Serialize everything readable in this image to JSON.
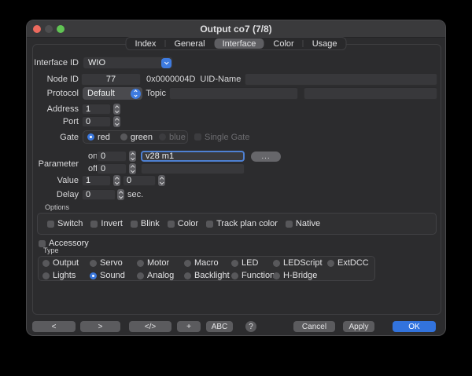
{
  "window": {
    "title": "Output co7 (7/8)"
  },
  "tabs": {
    "items": [
      {
        "label": "Index",
        "selected": false
      },
      {
        "label": "General",
        "selected": false
      },
      {
        "label": "Interface",
        "selected": true
      },
      {
        "label": "Color",
        "selected": false
      },
      {
        "label": "Usage",
        "selected": false
      }
    ]
  },
  "form": {
    "interface_id": {
      "label": "Interface ID",
      "value": "WIO"
    },
    "node": {
      "label": "Node ID",
      "value": "77",
      "hex": "0x0000004D",
      "uid_label": "UID-Name",
      "uid_value": ""
    },
    "protocol": {
      "label": "Protocol",
      "value": "Default",
      "topic_label": "Topic",
      "topic_value": "",
      "aux_value": ""
    },
    "address": {
      "label": "Address",
      "value": "1"
    },
    "port": {
      "label": "Port",
      "value": "0"
    },
    "gate": {
      "label": "Gate",
      "red": "red",
      "green": "green",
      "blue": "blue",
      "selected": "red",
      "blue_disabled": true,
      "single_gate": "Single Gate",
      "single_gate_disabled": true
    },
    "parameter": {
      "label": "Parameter",
      "on_label": "on",
      "on_count": "0",
      "on_text": "v28 m1",
      "off_label": "off",
      "off_count": "0",
      "off_text": "",
      "browse": "..."
    },
    "value": {
      "label": "Value",
      "first": "1",
      "second": "0"
    },
    "delay": {
      "label": "Delay",
      "value": "0",
      "unit": "sec."
    }
  },
  "options": {
    "label": "Options",
    "items": [
      {
        "label": "Switch",
        "checked": false
      },
      {
        "label": "Invert",
        "checked": false
      },
      {
        "label": "Blink",
        "checked": false
      },
      {
        "label": "Color",
        "checked": false
      },
      {
        "label": "Track plan color",
        "checked": false
      },
      {
        "label": "Native",
        "checked": false
      }
    ]
  },
  "accessory": {
    "label": "Accessory",
    "checked": false
  },
  "type": {
    "label": "Type",
    "selected": "Sound",
    "row1": [
      {
        "label": "Output"
      },
      {
        "label": "Servo"
      },
      {
        "label": "Motor"
      },
      {
        "label": "Macro"
      },
      {
        "label": "LED"
      },
      {
        "label": "LEDScript"
      },
      {
        "label": "ExtDCC"
      }
    ],
    "row2": [
      {
        "label": "Lights"
      },
      {
        "label": "Sound"
      },
      {
        "label": "Analog"
      },
      {
        "label": "Backlight"
      },
      {
        "label": "Function"
      },
      {
        "label": "H-Bridge"
      }
    ]
  },
  "footer": {
    "prev": "<",
    "next": ">",
    "code": "</>",
    "add": "+",
    "abc": "ABC",
    "help": "?",
    "cancel": "Cancel",
    "apply": "Apply",
    "ok": "OK"
  },
  "colors": {
    "accent_blue": "#3b78dd",
    "ok_button": "#3273dd",
    "window_bg": "#2c2c2e",
    "titlebar_bg": "#3a3a3c",
    "field_bg": "#38383b",
    "focus_ring": "#4e80d2",
    "traffic_red": "#ec6a5e",
    "traffic_middle": "#4e4e50",
    "traffic_green": "#61c454"
  }
}
